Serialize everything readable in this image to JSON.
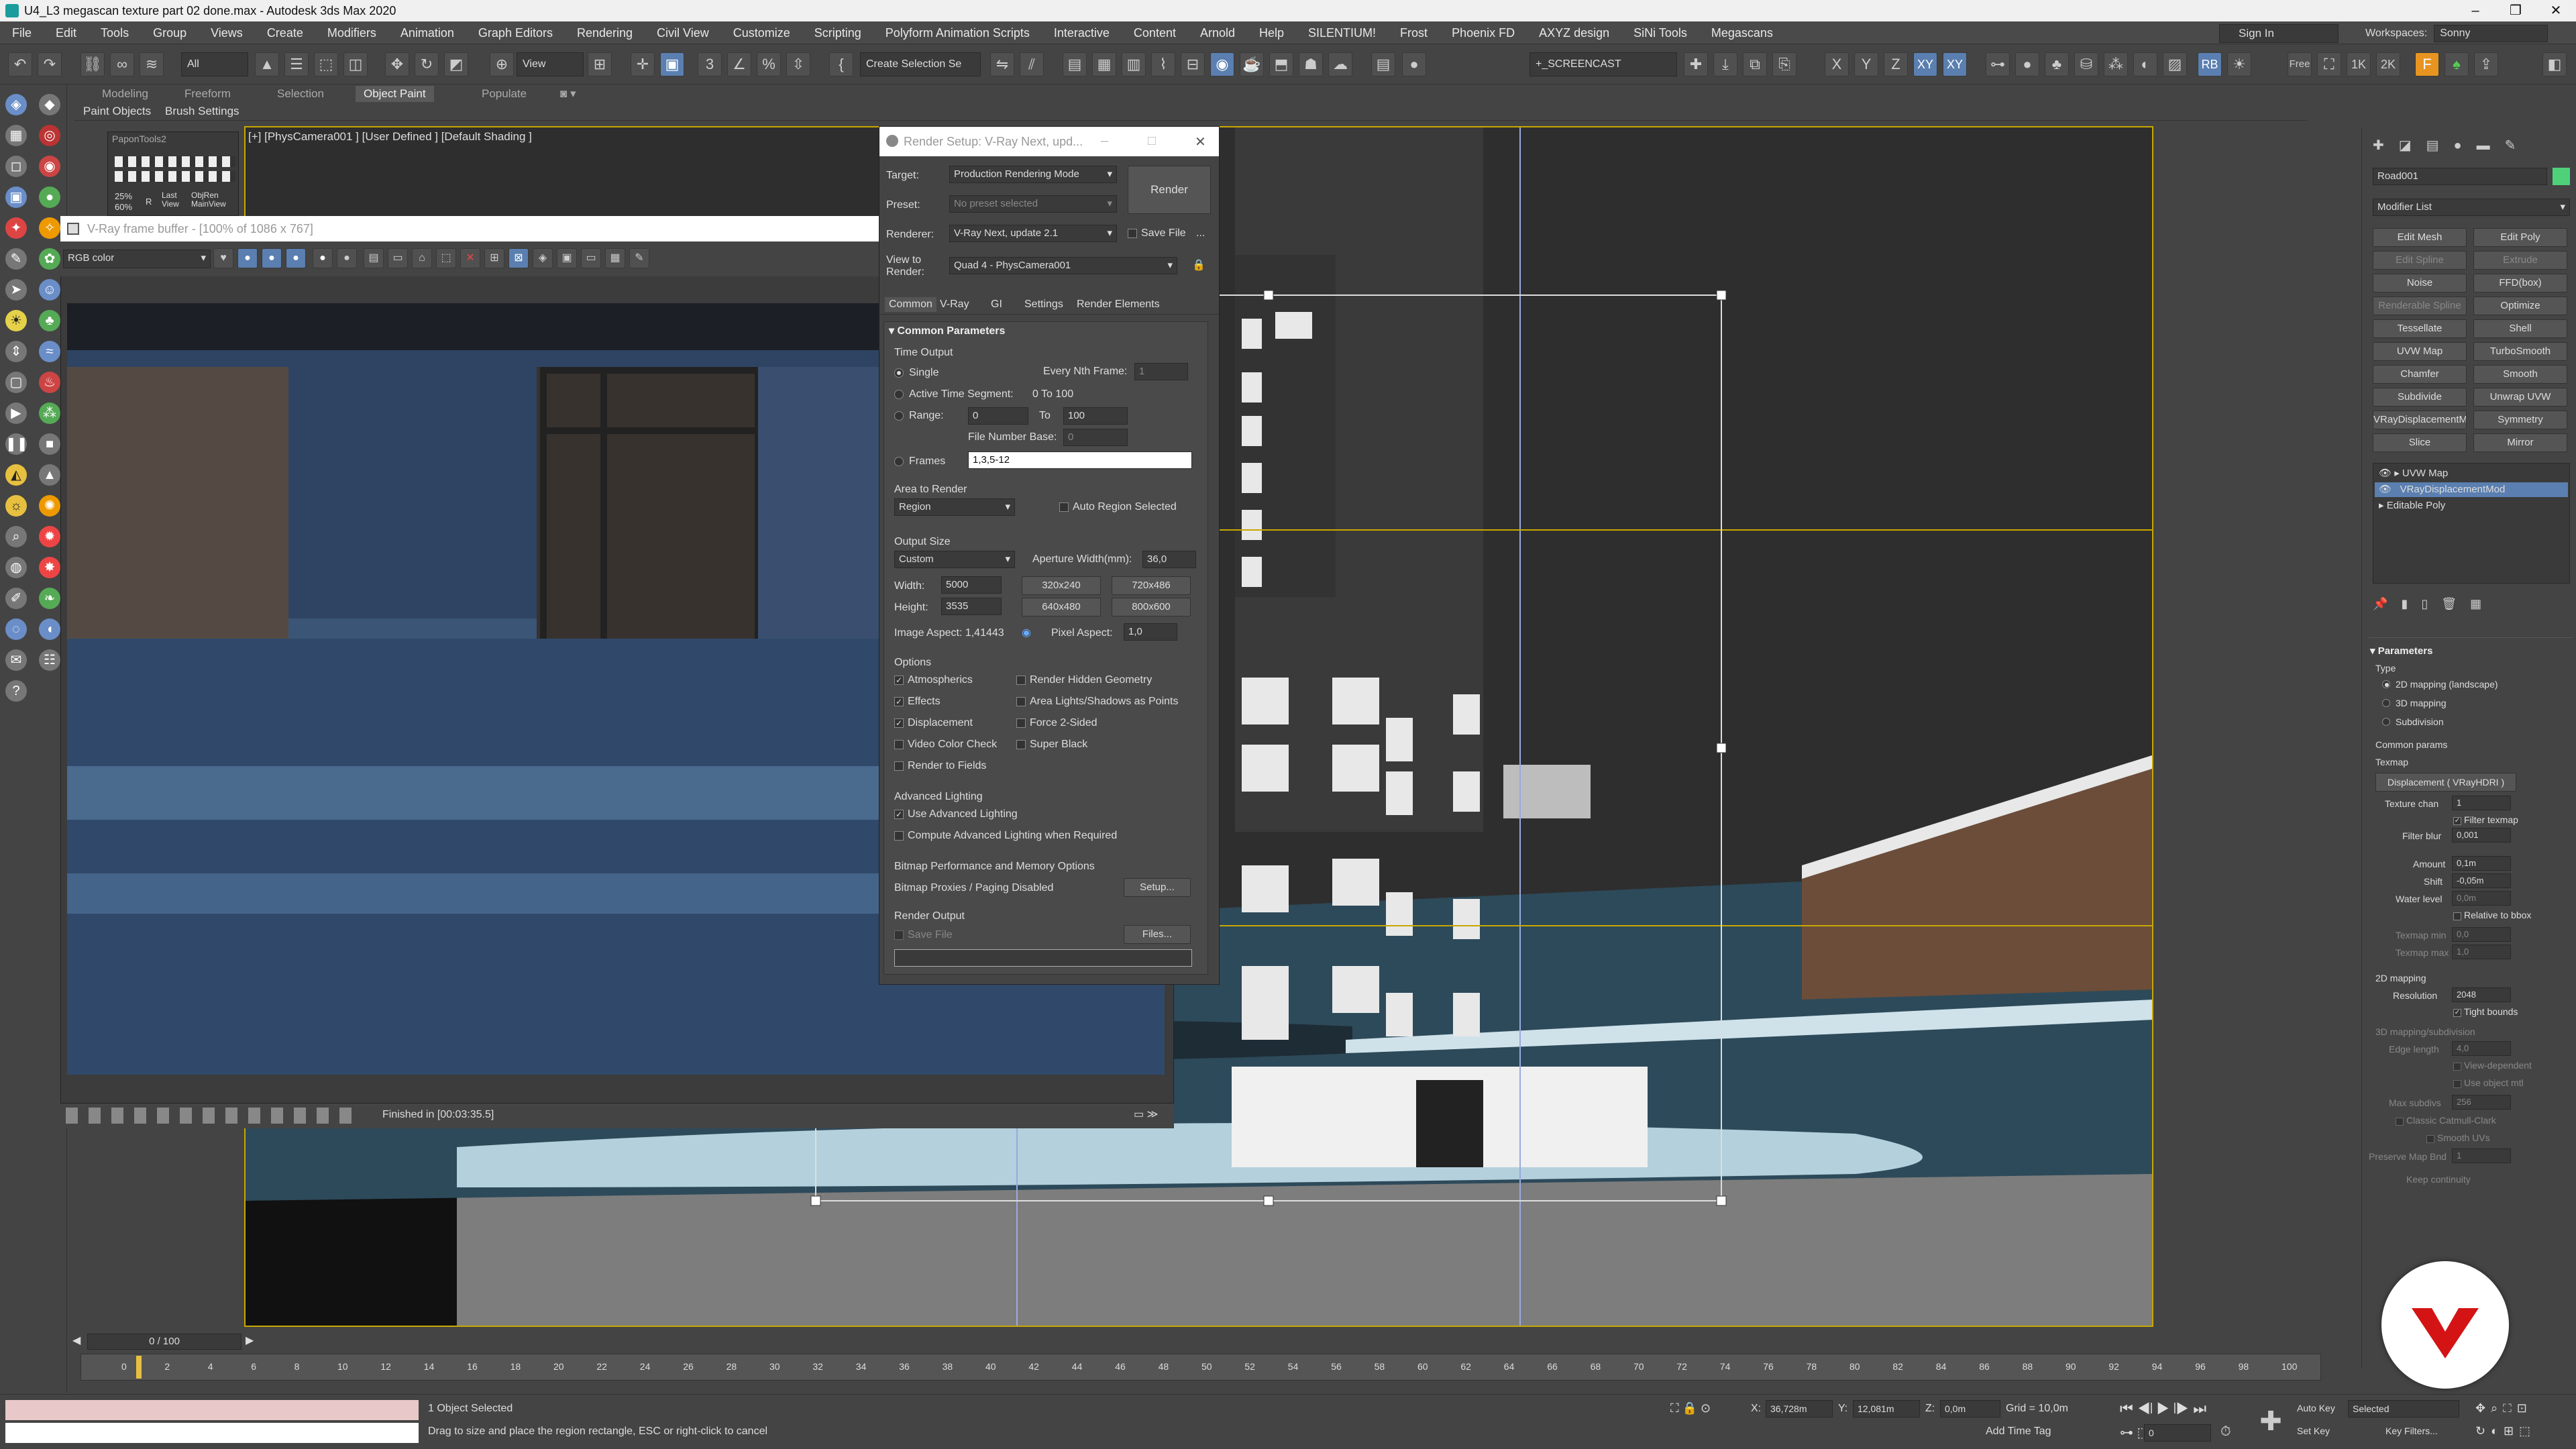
{
  "app": {
    "title": "U4_L3 megascan texture part 02 done.max - Autodesk 3ds Max 2020",
    "controls": {
      "minimize": "–",
      "maximize": "❐",
      "close": "✕"
    }
  },
  "menu": {
    "items": [
      "File",
      "Edit",
      "Tools",
      "Group",
      "Views",
      "Create",
      "Modifiers",
      "Animation",
      "Graph Editors",
      "Rendering",
      "Civil View",
      "Customize",
      "Scripting",
      "Polyform Animation Scripts",
      "Interactive",
      "Content",
      "Arnold",
      "Help",
      "SILENTIUM!",
      "Frost",
      "Phoenix FD",
      "AXYZ design",
      "SiNi Tools",
      "Megascans"
    ],
    "signin": "Sign In",
    "workspaces_label": "Workspaces:",
    "workspaces_value": "Sonny"
  },
  "toolbar": {
    "filter_dropdown": "All",
    "refcoord_dropdown": "View",
    "selection_set": "Create Selection Se",
    "screencast_field": "+_SCREENCAST",
    "axis_x": "X",
    "axis_y": "Y",
    "axis_z": "Z",
    "axis_xy": "XY",
    "axis_xy2": "XY",
    "res_1k": "1K",
    "res_2k": "2K",
    "free": "Free",
    "rb": "RB"
  },
  "ribbon": {
    "tabs": [
      "Modeling",
      "Freeform",
      "Selection",
      "Object Paint",
      "Populate"
    ],
    "active_tab": "Object Paint",
    "subtabs": [
      "Paint Objects",
      "Brush Settings"
    ]
  },
  "mini_panel": {
    "title": "PaponTools2",
    "pct": "25%",
    "pct2": "60%",
    "r": "R",
    "last_view": "Last View",
    "obj_render": "ObjRen MainView"
  },
  "viewport": {
    "label": "[+] [PhysCamera001 ] [User Defined ] [Default Shading ]",
    "accent": "#c8a800"
  },
  "vfb": {
    "title": "V-Ray frame buffer - [100% of 1086 x 767]",
    "channel": "RGB color",
    "status": "Finished in [00:03:35.5]"
  },
  "render_setup": {
    "title": "Render Setup: V-Ray Next, upd...",
    "target_label": "Target:",
    "target_value": "Production Rendering Mode",
    "preset_label": "Preset:",
    "preset_value": "No preset selected",
    "renderer_label": "Renderer:",
    "renderer_value": "V-Ray Next, update 2.1",
    "save_file_label": "Save File",
    "more": "...",
    "view_label": "View to Render:",
    "view_value": "Quad 4 - PhysCamera001",
    "render_button": "Render",
    "tabs": [
      "Common",
      "V-Ray",
      "GI",
      "Settings",
      "Render Elements"
    ],
    "common_params": "Common Parameters",
    "time_output": {
      "header": "Time Output",
      "single": "Single",
      "every_nth": "Every Nth Frame:",
      "every_nth_value": "1",
      "active_segment": "Active Time Segment:",
      "active_segment_value": "0 To 100",
      "range": "Range:",
      "range_from": "0",
      "range_to_label": "To",
      "range_to": "100",
      "file_number_base": "File Number Base:",
      "file_number_base_value": "0",
      "frames": "Frames",
      "frames_value": "1,3,5-12"
    },
    "area": {
      "header": "Area to Render",
      "value": "Region",
      "auto_region": "Auto Region Selected"
    },
    "output_size": {
      "header": "Output Size",
      "preset": "Custom",
      "aperture_label": "Aperture Width(mm):",
      "aperture_value": "36,0",
      "width_label": "Width:",
      "width_value": "5000",
      "height_label": "Height:",
      "height_value": "3535",
      "p1": "320x240",
      "p2": "720x486",
      "p3": "640x480",
      "p4": "800x600",
      "image_aspect": "Image Aspect: 1,41443",
      "pixel_aspect_label": "Pixel Aspect:",
      "pixel_aspect_value": "1,0"
    },
    "options": {
      "header": "Options",
      "atmospherics": "Atmospherics",
      "render_hidden": "Render Hidden Geometry",
      "effects": "Effects",
      "area_lights": "Area Lights/Shadows as Points",
      "displacement": "Displacement",
      "force2sided": "Force 2-Sided",
      "video_color": "Video Color Check",
      "super_black": "Super Black",
      "render_fields": "Render to Fields"
    },
    "advanced": {
      "header": "Advanced Lighting",
      "use": "Use Advanced Lighting",
      "compute": "Compute Advanced Lighting when Required"
    },
    "bitmap": {
      "header": "Bitmap Performance and Memory Options",
      "status": "Bitmap Proxies / Paging Disabled",
      "setup": "Setup..."
    },
    "output": {
      "header": "Render Output",
      "save_file": "Save File",
      "files": "Files..."
    }
  },
  "right_panel": {
    "object_name": "Road001",
    "object_color": "#4fd17a",
    "modifier_list": "Modifier List",
    "buttons": [
      [
        "Edit Mesh",
        "Edit Poly"
      ],
      [
        "Edit Spline",
        "Extrude"
      ],
      [
        "Noise",
        "FFD(box)"
      ],
      [
        "Renderable Spline",
        "Optimize"
      ],
      [
        "Tessellate",
        "Shell"
      ],
      [
        "UVW Map",
        "TurboSmooth"
      ],
      [
        "Chamfer",
        "Smooth"
      ],
      [
        "Subdivide",
        "Unwrap UVW"
      ],
      [
        "VRayDisplacementMo",
        "Symmetry"
      ],
      [
        "Slice",
        "Mirror"
      ]
    ],
    "stack": [
      "UVW Map",
      "VRayDisplacementMod",
      "Editable Poly"
    ],
    "params": {
      "header": "Parameters",
      "type_label": "Type",
      "types": [
        "2D mapping (landscape)",
        "3D mapping",
        "Subdivision"
      ],
      "common_params": "Common params",
      "texmap_label": "Texmap",
      "texmap_value": "Displacement ( VRayHDRI )",
      "texture_chan_label": "Texture chan",
      "texture_chan_value": "1",
      "filter_texmap": "Filter texmap",
      "filter_blur_label": "Filter blur",
      "filter_blur_value": "0,001",
      "amount_label": "Amount",
      "amount_value": "0,1m",
      "shift_label": "Shift",
      "shift_value": "-0,05m",
      "water_label": "Water level",
      "water_value": "0,0m",
      "relative_bbox": "Relative to bbox",
      "texmap_min_label": "Texmap min",
      "texmap_min_value": "0,0",
      "texmap_max_label": "Texmap max",
      "texmap_max_value": "1,0",
      "mapping2d": "2D mapping",
      "resolution_label": "Resolution",
      "resolution_value": "2048",
      "tight_bounds": "Tight bounds",
      "mapping3d": "3D mapping/subdivision",
      "edge_length_label": "Edge length",
      "edge_length_value": "4,0",
      "view_dependent": "View-dependent",
      "use_object_mtl": "Use object mtl",
      "max_subdivs_label": "Max subdivs",
      "max_subdivs_value": "256",
      "classic": "Classic Catmull-Clark",
      "smooth_uvs": "Smooth UVs",
      "preserve_label": "Preserve Map Bnd",
      "preserve_value": "1",
      "continuity": "Keep continuity"
    }
  },
  "timeline": {
    "position": "0 / 100",
    "ticks": [
      "0",
      "2",
      "4",
      "6",
      "8",
      "10",
      "12",
      "14",
      "16",
      "18",
      "20",
      "22",
      "24",
      "26",
      "28",
      "30",
      "32",
      "34",
      "36",
      "38",
      "40",
      "42",
      "44",
      "46",
      "48",
      "50",
      "52",
      "54",
      "56",
      "58",
      "60",
      "62",
      "64",
      "66",
      "68",
      "70",
      "72",
      "74",
      "76",
      "78",
      "80",
      "82",
      "84",
      "86",
      "88",
      "90",
      "92",
      "94",
      "96",
      "98",
      "100"
    ]
  },
  "status": {
    "selection": "1 Object Selected",
    "prompt": "Drag to size and place the region rectangle, ESC or right-click to cancel",
    "x_label": "X:",
    "x_value": "36,728m",
    "y_label": "Y:",
    "y_value": "12,081m",
    "z_label": "Z:",
    "z_value": "0,0m",
    "grid": "Grid = 10,0m",
    "add_time_tag": "Add Time Tag",
    "auto_key": "Auto Key",
    "set_key": "Set Key",
    "selected": "Selected",
    "key_filters": "Key Filters...",
    "frame": "0"
  }
}
